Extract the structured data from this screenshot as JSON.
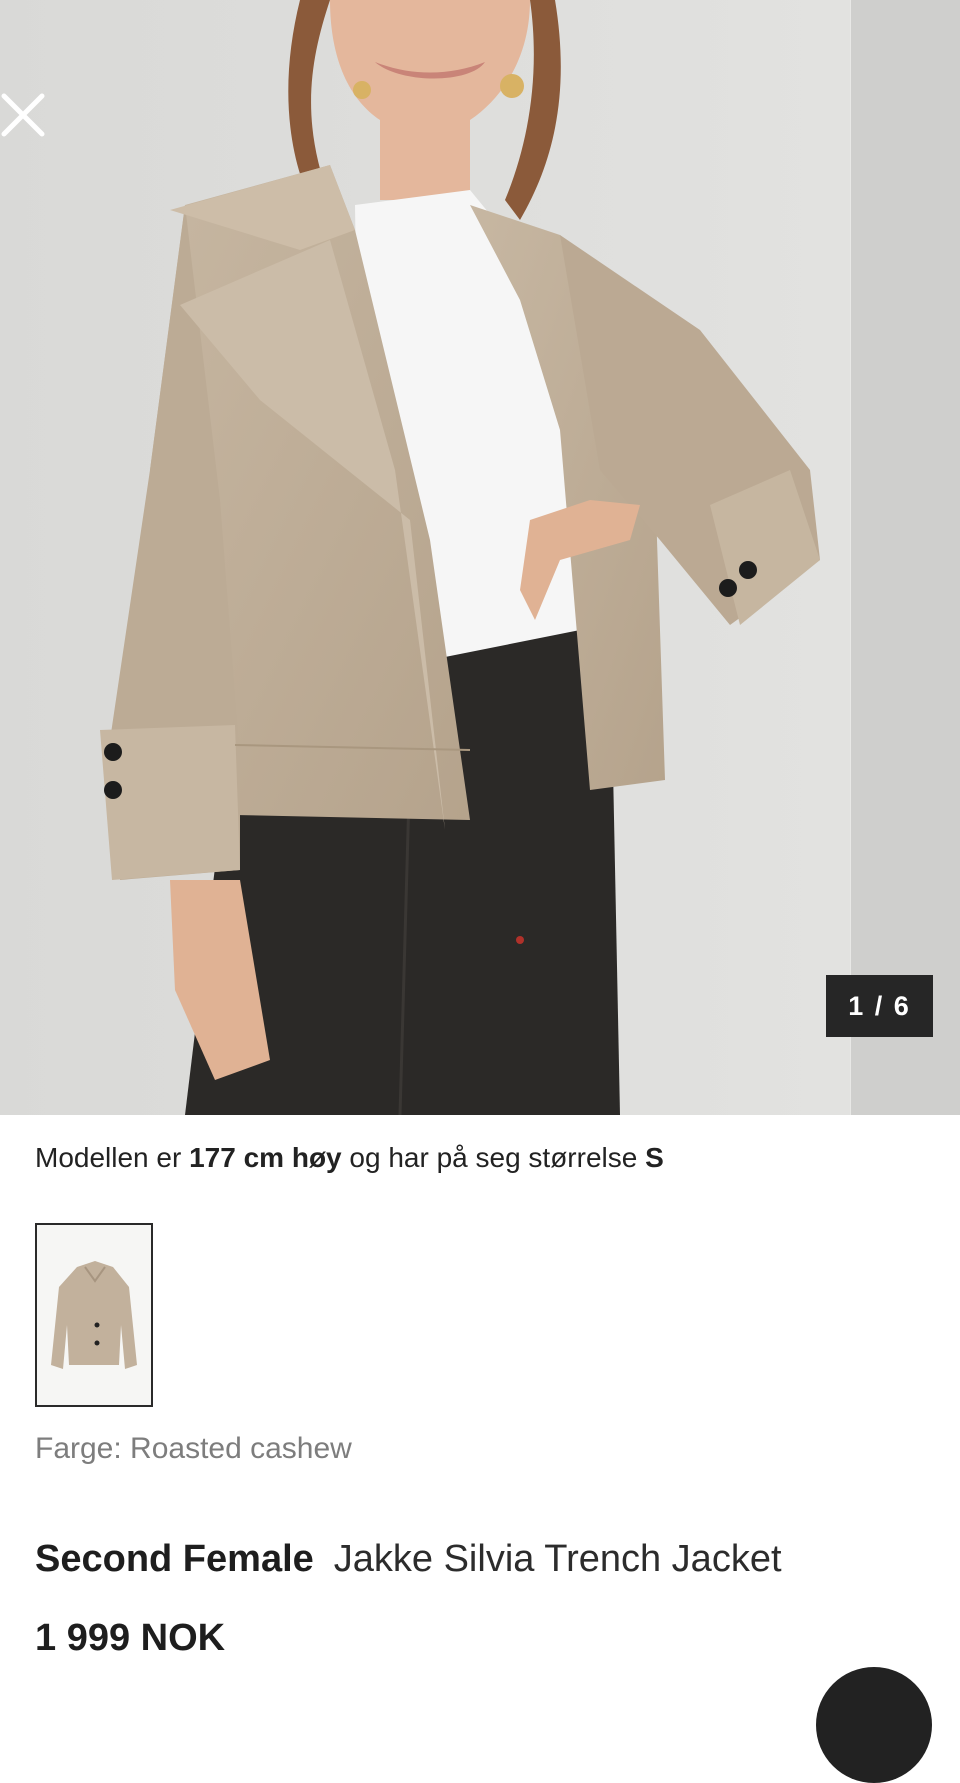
{
  "gallery": {
    "counter": "1 / 6"
  },
  "model_info": {
    "prefix": "Modellen er ",
    "height": "177 cm høy",
    "middle": " og har på seg størrelse ",
    "size": "S"
  },
  "color": {
    "label": "Farge: Roasted cashew"
  },
  "product": {
    "brand": "Second Female",
    "name": "Jakke Silvia Trench Jacket",
    "price": "1 999 NOK"
  },
  "icons": {
    "close": "close-icon",
    "fab": "bag-icon"
  },
  "colors": {
    "jacket": "#c2b19c",
    "counter_bg": "#262626",
    "muted_text": "#7d7d7d"
  }
}
